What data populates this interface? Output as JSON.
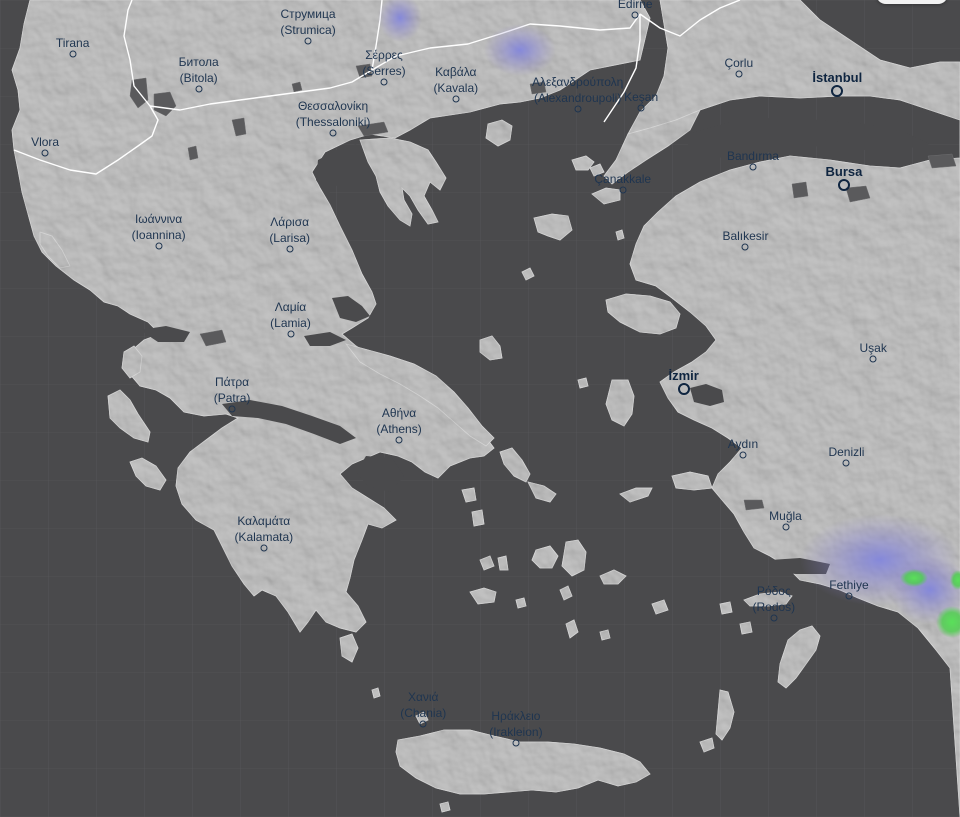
{
  "map": {
    "colors": {
      "sea": "#4a4a4c",
      "land": "#b4b4b4",
      "border": "#ffffff",
      "lake": "#5a5a5c",
      "label": "#1f3550",
      "precip_light": "#8a80c8",
      "precip_mid": "#5b7fd8",
      "precip_heavy": "#4cd04c"
    },
    "cities": [
      {
        "id": "edirne",
        "name": "Edirne",
        "lat": 41.67,
        "lon": 26.56
      },
      {
        "id": "strumica",
        "name": "Струмица",
        "alt": "(Strumica)",
        "lat": 41.44,
        "lon": 22.64
      },
      {
        "id": "tirana",
        "name": "Tirana",
        "lat": 41.33,
        "lon": 19.82
      },
      {
        "id": "bitola",
        "name": "Битола",
        "alt": "(Bitola)",
        "lat": 41.03,
        "lon": 21.33
      },
      {
        "id": "serres",
        "name": "Σέρρες",
        "alt": "(Serres)",
        "lat": 41.09,
        "lon": 23.55
      },
      {
        "id": "kavala",
        "name": "Καβάλα",
        "alt": "(Kavala)",
        "lat": 40.94,
        "lon": 24.41
      },
      {
        "id": "alexandroupoli",
        "name": "Αλεξανδρούπολη",
        "alt": "(Alexandroupoli)",
        "lat": 40.85,
        "lon": 25.87
      },
      {
        "id": "kesan",
        "name": "Keşan",
        "lat": 40.86,
        "lon": 26.63
      },
      {
        "id": "corlu",
        "name": "Çorlu",
        "lat": 41.16,
        "lon": 27.8
      },
      {
        "id": "istanbul",
        "name": "İstanbul",
        "lat": 41.01,
        "lon": 28.98,
        "major": true
      },
      {
        "id": "thessaloniki",
        "name": "Θεσσαλονίκη",
        "alt": "(Thessaloniki)",
        "lat": 40.64,
        "lon": 22.94
      },
      {
        "id": "vlora",
        "name": "Vlora",
        "lat": 40.47,
        "lon": 19.49
      },
      {
        "id": "bandirma",
        "name": "Bandırma",
        "lat": 40.35,
        "lon": 27.97
      },
      {
        "id": "bursa",
        "name": "Bursa",
        "lat": 40.19,
        "lon": 29.06,
        "major": true
      },
      {
        "id": "canakkale",
        "name": "Çanakkale",
        "lat": 40.15,
        "lon": 26.41
      },
      {
        "id": "ioannina",
        "name": "Ιωάννινα",
        "alt": "(Ioannina)",
        "lat": 39.66,
        "lon": 20.85
      },
      {
        "id": "larisa",
        "name": "Λάρισα",
        "alt": "(Larisa)",
        "lat": 39.64,
        "lon": 22.42
      },
      {
        "id": "balikesir",
        "name": "Balıkesir",
        "lat": 39.65,
        "lon": 27.88
      },
      {
        "id": "lamia",
        "name": "Λαμία",
        "alt": "(Lamia)",
        "lat": 38.9,
        "lon": 22.43
      },
      {
        "id": "usak",
        "name": "Uşak",
        "lat": 38.68,
        "lon": 29.41
      },
      {
        "id": "izmir",
        "name": "İzmir",
        "lat": 38.42,
        "lon": 27.14,
        "major": true
      },
      {
        "id": "patra",
        "name": "Πάτρα",
        "alt": "(Patra)",
        "lat": 38.25,
        "lon": 21.73
      },
      {
        "id": "athens",
        "name": "Αθήνα",
        "alt": "(Athens)",
        "lat": 37.98,
        "lon": 23.73
      },
      {
        "id": "aydin",
        "name": "Aydın",
        "lat": 37.85,
        "lon": 27.85
      },
      {
        "id": "denizli",
        "name": "Denizli",
        "lat": 37.78,
        "lon": 29.09
      },
      {
        "id": "mugla",
        "name": "Muğla",
        "lat": 37.22,
        "lon": 28.36
      },
      {
        "id": "kalamata",
        "name": "Καλαμάτα",
        "alt": "(Kalamata)",
        "lat": 37.04,
        "lon": 22.11
      },
      {
        "id": "rodos",
        "name": "Ρόδος",
        "alt": "(Rodos)",
        "lat": 36.43,
        "lon": 28.22
      },
      {
        "id": "fethiye",
        "name": "Fethiye",
        "lat": 36.62,
        "lon": 29.12
      },
      {
        "id": "chania",
        "name": "Χανιά",
        "alt": "(Chania)",
        "lat": 35.51,
        "lon": 24.02
      },
      {
        "id": "irakleion",
        "name": "Ηράκλειο",
        "alt": "(Irakleion)",
        "lat": 35.34,
        "lon": 25.13
      }
    ]
  }
}
